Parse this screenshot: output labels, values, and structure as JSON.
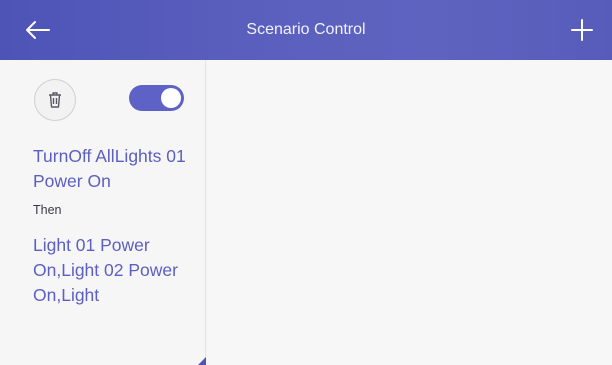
{
  "header": {
    "title": "Scenario Control"
  },
  "scenario": {
    "enabled": true,
    "condition": "TurnOff AllLights 01 Power On",
    "then_label": "Then",
    "action": "Light 01 Power On,Light 02 Power On,Light"
  },
  "icons": {
    "back": "arrow-left-icon",
    "add": "plus-icon",
    "delete": "trash-icon"
  },
  "colors": {
    "header_start": "#4d54b6",
    "header_end": "#5f63c0",
    "accent": "#5e62c6",
    "background": "#f7f6f7"
  }
}
